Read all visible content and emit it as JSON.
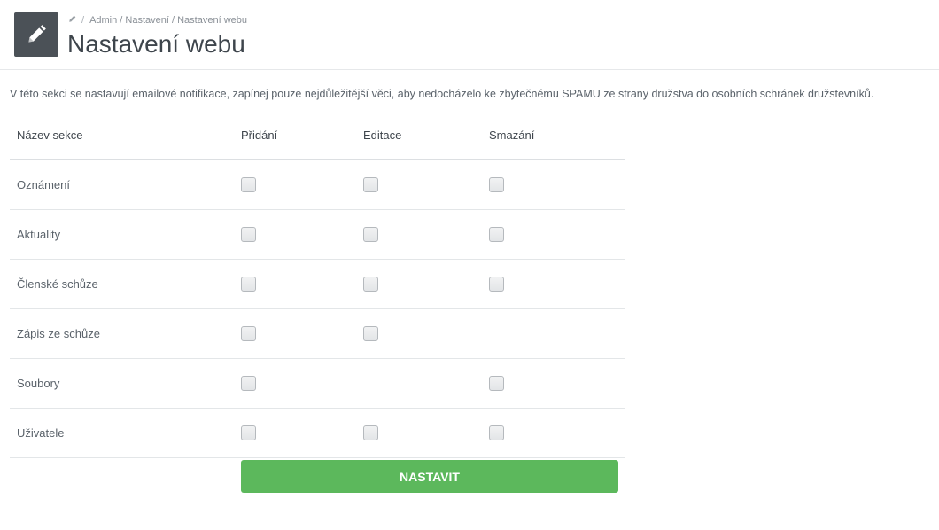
{
  "header": {
    "title": "Nastavení webu",
    "breadcrumb": "Admin / Nastavení / Nastavení webu",
    "icon": "pencil-icon"
  },
  "intro_text": "V této sekci se nastavují emailové notifikace, zapínej pouze nejdůležitější věci, aby nedocházelo ke zbytečnému SPAMU ze strany družstva do osobních schránek družstevníků.",
  "table": {
    "columns": [
      "Název sekce",
      "Přidání",
      "Editace",
      "Smazání"
    ],
    "rows": [
      {
        "label": "Oznámení",
        "add": true,
        "edit": true,
        "delete": true
      },
      {
        "label": "Aktuality",
        "add": true,
        "edit": true,
        "delete": true
      },
      {
        "label": "Členské schůze",
        "add": true,
        "edit": true,
        "delete": true
      },
      {
        "label": "Zápis ze schůze",
        "add": true,
        "edit": true,
        "delete": false
      },
      {
        "label": "Soubory",
        "add": true,
        "edit": false,
        "delete": true
      },
      {
        "label": "Uživatele",
        "add": true,
        "edit": true,
        "delete": true
      }
    ]
  },
  "submit_label": "NASTAVIT",
  "colors": {
    "accent": "#5cb85c",
    "icon_box": "#4b5157"
  }
}
